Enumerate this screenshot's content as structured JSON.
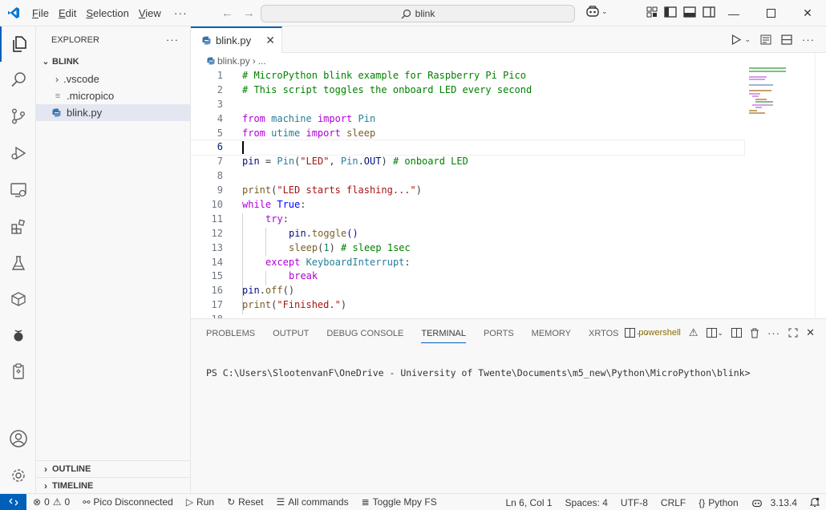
{
  "titlebar": {
    "menu": [
      "File",
      "Edit",
      "Selection",
      "View"
    ],
    "menu_underline": [
      "F",
      "E",
      "S",
      "V"
    ],
    "menu_rest": [
      "ile",
      "dit",
      "election",
      "iew"
    ],
    "more": "···",
    "search": "blink"
  },
  "sidebar": {
    "title": "EXPLORER",
    "more": "···",
    "folder": "BLINK",
    "items": [
      ".vscode",
      ".micropico",
      "blink.py"
    ],
    "outline": "OUTLINE",
    "timeline": "TIMELINE"
  },
  "editor": {
    "tab": "blink.py",
    "breadcrumb_file": "blink.py",
    "breadcrumb_more": "...",
    "line_numbers": [
      "1",
      "2",
      "3",
      "4",
      "5",
      "6",
      "7",
      "8",
      "9",
      "10",
      "11",
      "12",
      "13",
      "14",
      "15",
      "16",
      "17",
      "18"
    ],
    "code": {
      "l1": "# MicroPython blink example for Raspberry Pi Pico",
      "l2": "# This script toggles the onboard LED every second",
      "l4_from": "from",
      "l4_mod": " machine ",
      "l4_imp": "import",
      "l4_name": " Pin",
      "l5_from": "from",
      "l5_mod": " utime ",
      "l5_imp": "import",
      "l5_name": " sleep",
      "l7_pin": "pin",
      "l7_eq": " = ",
      "l7_cls": "Pin",
      "l7_p1": "(",
      "l7_str": "\"LED\"",
      "l7_comma": ", ",
      "l7_pin2": "Pin",
      "l7_dot": ".",
      "l7_out": "OUT",
      "l7_p2": ") ",
      "l7_cmt": "# onboard LED",
      "l9_fn": "print",
      "l9_p1": "(",
      "l9_str": "\"LED starts flashing...\"",
      "l9_p2": ")",
      "l10_kw": "while",
      "l10_val": " True",
      "l10_colon": ":",
      "l11_kw": "try",
      "l11_colon": ":",
      "l12_obj": "pin",
      "l12_dot": ".",
      "l12_fn": "toggle",
      "l12_paren": "()",
      "l13_fn": "sleep",
      "l13_p1": "(",
      "l13_num": "1",
      "l13_p2": ") ",
      "l13_cmt": "# sleep 1sec",
      "l14_kw": "except",
      "l14_exc": " KeyboardInterrupt",
      "l14_colon": ":",
      "l15_kw": "break",
      "l16_obj": "pin",
      "l16_dot": ".",
      "l16_fn": "off",
      "l16_paren": "()",
      "l17_fn": "print",
      "l17_p1": "(",
      "l17_str": "\"Finished.\"",
      "l17_p2": ")"
    }
  },
  "panel": {
    "tabs": [
      "PROBLEMS",
      "OUTPUT",
      "DEBUG CONSOLE",
      "TERMINAL",
      "PORTS",
      "MEMORY",
      "XRTOS"
    ],
    "more": "···",
    "shell": "powershell",
    "prompt": "PS C:\\Users\\SlootenvanF\\OneDrive - University of Twente\\Documents\\m5_new\\Python\\MicroPython\\blink>"
  },
  "statusbar": {
    "errors": "0",
    "warnings": "0",
    "pico": "Pico Disconnected",
    "run": "Run",
    "reset": "Reset",
    "all_commands": "All commands",
    "toggle_fs": "Toggle Mpy FS",
    "position": "Ln 6, Col 1",
    "spaces": "Spaces: 4",
    "encoding": "UTF-8",
    "eol": "CRLF",
    "language": "Python",
    "python_version": "3.13.4"
  },
  "colors": {
    "accent": "#005fb8",
    "comment": "#008000",
    "keyword": "#af00db",
    "string": "#a31515",
    "function": "#795e26"
  }
}
